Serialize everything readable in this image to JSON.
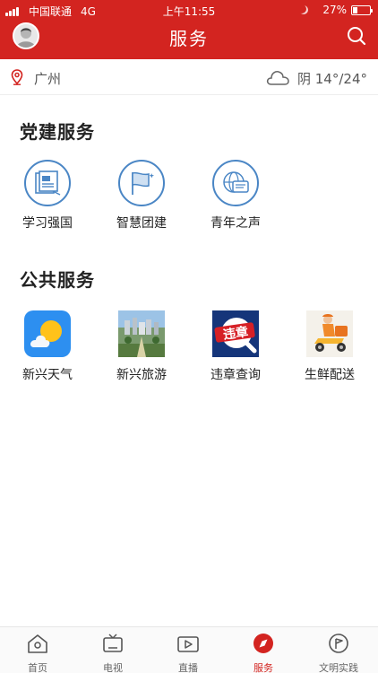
{
  "status_bar": {
    "carrier": "中国联通",
    "network": "4G",
    "time": "上午11:55",
    "battery": "27%",
    "battery_level": 0.27
  },
  "header": {
    "title": "服务"
  },
  "location": {
    "city": "广州",
    "weather": "阴 14°/24°"
  },
  "sections": {
    "party": {
      "title": "党建服务",
      "items": [
        {
          "label": "学习强国",
          "icon": "study-icon"
        },
        {
          "label": "智慧团建",
          "icon": "flag-icon"
        },
        {
          "label": "青年之声",
          "icon": "globe-chat-icon"
        }
      ]
    },
    "public": {
      "title": "公共服务",
      "items": [
        {
          "label": "新兴天气",
          "icon": "weather-app-icon"
        },
        {
          "label": "新兴旅游",
          "icon": "tourism-photo"
        },
        {
          "label": "违章查询",
          "icon": "violation-icon",
          "badge": "违章"
        },
        {
          "label": "生鲜配送",
          "icon": "delivery-icon"
        }
      ]
    }
  },
  "tabbar": {
    "items": [
      {
        "label": "首页",
        "icon": "home-icon"
      },
      {
        "label": "电视",
        "icon": "tv-icon"
      },
      {
        "label": "直播",
        "icon": "live-icon"
      },
      {
        "label": "服务",
        "icon": "compass-icon",
        "active": true
      },
      {
        "label": "文明实践",
        "icon": "flag-circle-icon"
      }
    ]
  },
  "colors": {
    "brand_red": "#d32420",
    "icon_blue": "#4a86c5"
  }
}
